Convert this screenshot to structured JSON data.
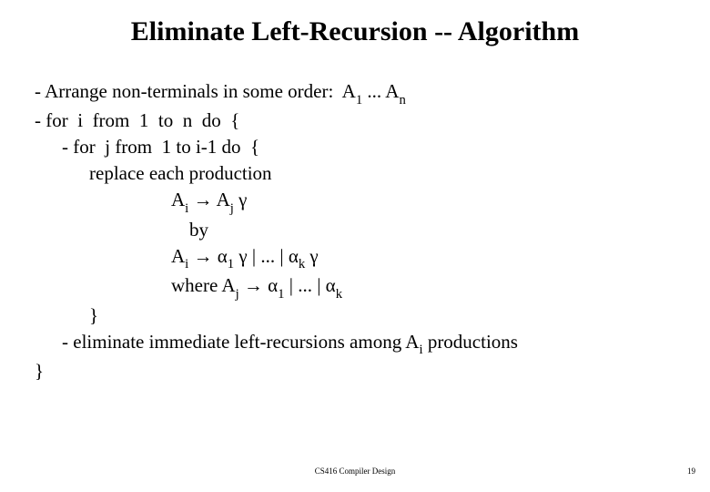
{
  "title": "Eliminate Left-Recursion -- Algorithm",
  "lines": {
    "l1a": "- Arrange non-terminals in some order:  A",
    "l1b": " ... A",
    "l2": "- for  i  from  1  to  n  do  {",
    "l3": "- for  j from  1 to i-1 do  {",
    "l4": "replace each production",
    "l5a": "A",
    "l5b": " → A",
    "l5c": " γ",
    "l6": "by",
    "l7a": "A",
    "l7b": " → α",
    "l7c": " γ | ... | α",
    "l7d": " γ",
    "l8a": "where A",
    "l8b": " → α",
    "l8c": " | ... | α",
    "l9": "}",
    "l10a": "- eliminate immediate left-recursions among A",
    "l10b": " productions",
    "l11": "}"
  },
  "subs": {
    "one": "1",
    "n": "n",
    "i": "i",
    "j": "j",
    "k": "k"
  },
  "footer": "CS416 Compiler Design",
  "page": "19"
}
